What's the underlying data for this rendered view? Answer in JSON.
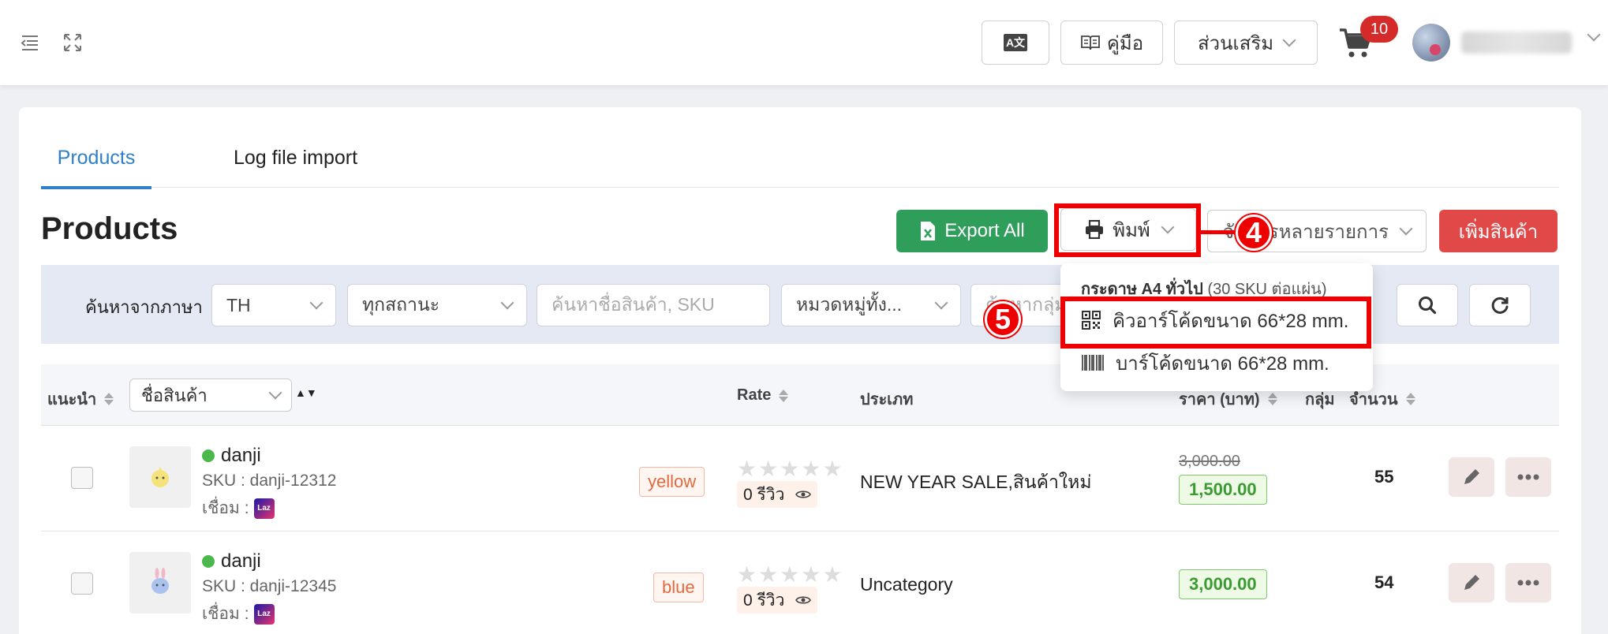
{
  "topbar": {
    "lang_icon_label": "A文",
    "manual_label": "คู่มือ",
    "addons_label": "ส่วนเสริม",
    "cart_count": "10"
  },
  "tabs": [
    {
      "label": "Products",
      "active": true
    },
    {
      "label": "Log file import",
      "active": false
    }
  ],
  "page_title": "Products",
  "toolbar": {
    "export_label": "Export All",
    "print_label": "พิมพ์",
    "multi_label": "จัดการหลายรายการ",
    "add_label": "เพิ่มสินค้า"
  },
  "steps": {
    "four": "4",
    "five": "5"
  },
  "filters": {
    "label": "ค้นหาจากภาษา",
    "language": "TH",
    "status": "ทุกสถานะ",
    "search_placeholder": "ค้นหาชื่อสินค้า, SKU",
    "category": "หมวดหมู่ทั้ง...",
    "group_placeholder": "ค้นหากลุ่ม"
  },
  "print_menu": {
    "header_bold": "กระดาษ A4 ทั่วไป",
    "header_note": "(30 SKU ต่อแผ่น)",
    "qr_label": "คิวอาร์โค้ดขนาด 66*28 mm.",
    "barcode_label": "บาร์โค้ดขนาด 66*28 mm."
  },
  "table": {
    "col_recommend": "แนะนำ",
    "col_name": "ชื่อสินค้า",
    "col_rate": "Rate",
    "col_type": "ประเภท",
    "col_price": "ราคา (บาท)",
    "col_group": "กลุ่ม",
    "col_qty": "จำนวน",
    "rows": [
      {
        "name": "danji",
        "sku": "SKU : danji-12312",
        "link": "เชื่อม :",
        "tag": "yellow",
        "reviews": "0 รีวิว",
        "type": "NEW YEAR SALE,สินค้าใหม่",
        "old_price": "3,000.00",
        "price": "1,500.00",
        "qty": "55"
      },
      {
        "name": "danji",
        "sku": "SKU : danji-12345",
        "link": "เชื่อม :",
        "tag": "blue",
        "reviews": "0 รีวิว",
        "type": "Uncategory",
        "old_price": "",
        "price": "3,000.00",
        "qty": "54"
      }
    ]
  },
  "colors": {
    "accent": "#2f80c8",
    "export": "#2f9e5b",
    "add": "#e14848",
    "annotation": "#ee0000"
  }
}
